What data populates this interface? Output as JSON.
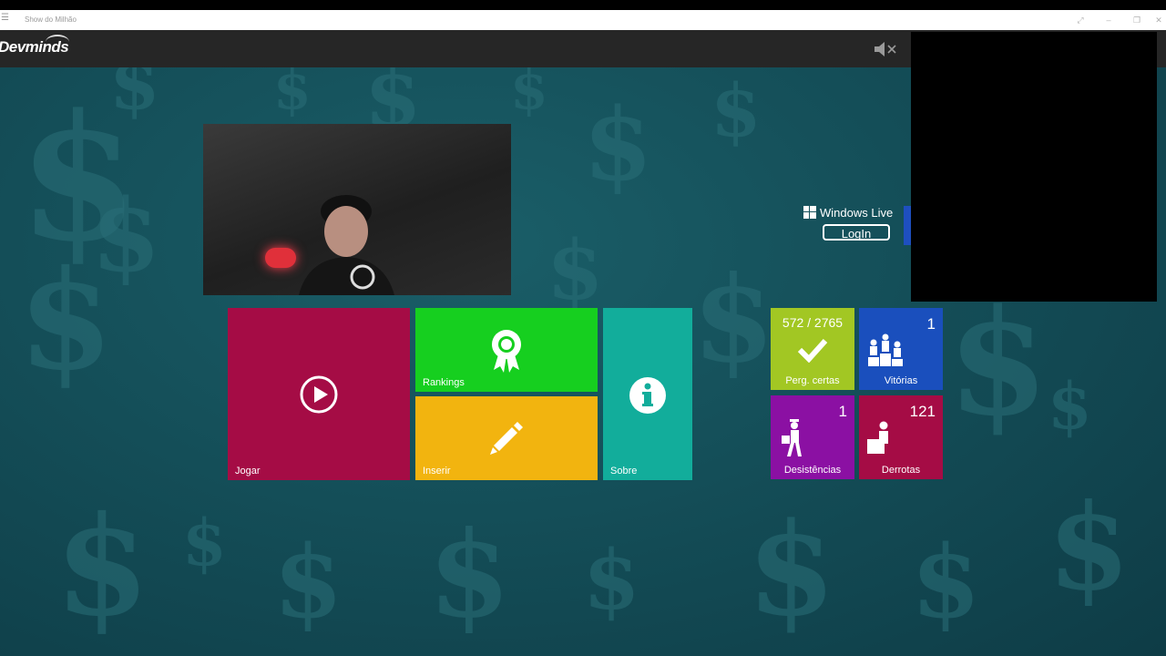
{
  "window": {
    "title": "Show do Milhão"
  },
  "app": {
    "logo_text": "Devminds"
  },
  "login": {
    "provider": "Windows Live",
    "button_label": "LogIn"
  },
  "menu": {
    "play": "Jogar",
    "rankings": "Rankings",
    "insert": "Inserir",
    "about": "Sobre"
  },
  "stats": {
    "correct": {
      "value": "572 / 2765",
      "label": "Perg. certas"
    },
    "wins": {
      "value": "1",
      "label": "Vitórias"
    },
    "quits": {
      "value": "1",
      "label": "Desistências"
    },
    "losses": {
      "value": "121",
      "label": "Derrotas"
    }
  },
  "icons": {
    "play": "play-circle-icon",
    "rankings": "award-ribbon-icon",
    "insert": "pencil-icon",
    "about": "info-icon",
    "correct": "checkmark-icon",
    "wins": "podium-icon",
    "quits": "walking-away-icon",
    "losses": "sad-sitting-icon",
    "sound": "speaker-muted-icon"
  },
  "colors": {
    "play_tile": "#a50c45",
    "rankings_tile": "#16cf1f",
    "insert_tile": "#f2b40f",
    "about_tile": "#12ad9b",
    "correct_tile": "#a2c723",
    "wins_tile": "#1a4fbd",
    "quits_tile": "#8b10a3",
    "losses_tile": "#a50c45",
    "background": "#134b55"
  }
}
